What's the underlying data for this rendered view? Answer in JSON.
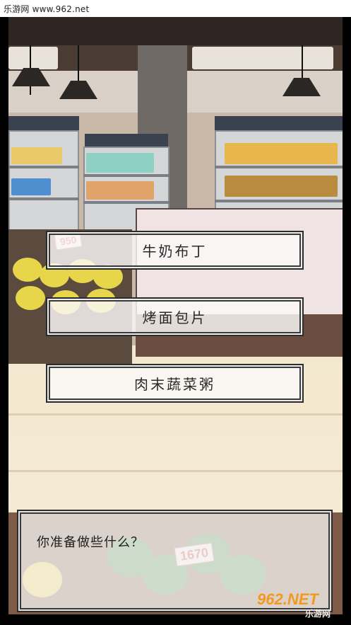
{
  "watermark": {
    "top_text": "乐游网 www.962.net",
    "logo_text": "962.NET",
    "logo_subtext": "乐游网"
  },
  "choices": [
    {
      "label": "牛奶布丁"
    },
    {
      "label": "烤面包片"
    },
    {
      "label": "肉末蔬菜粥"
    }
  ],
  "dialog": {
    "text": "你准备做些什么？"
  },
  "price_tags": [
    "950",
    "1670"
  ]
}
